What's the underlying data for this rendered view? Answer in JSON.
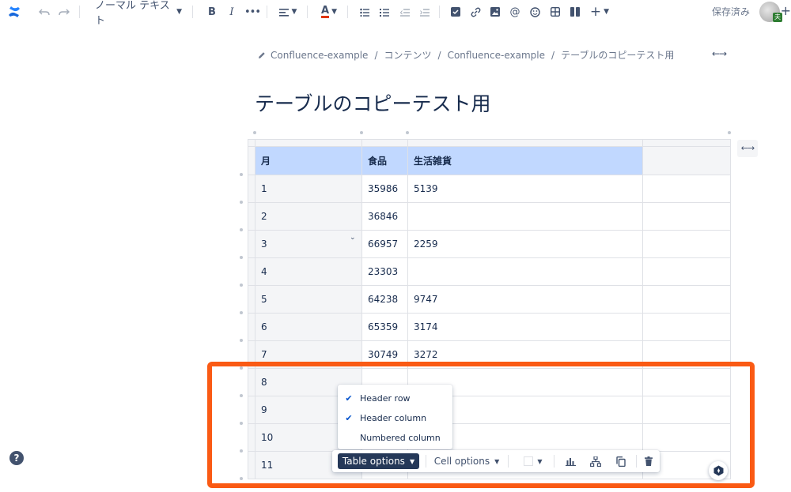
{
  "toolbar": {
    "text_style": "ノーマル テキスト",
    "saved_status": "保存済み",
    "avatar_badge": "夫"
  },
  "breadcrumb": [
    "Confluence-example",
    "コンテンツ",
    "Confluence-example",
    "テーブルのコピーテスト用"
  ],
  "page_title": "テーブルのコピーテスト用",
  "table": {
    "headers": [
      "月",
      "食品",
      "生活雑貨",
      ""
    ],
    "rows": [
      [
        "1",
        "35986",
        "5139",
        ""
      ],
      [
        "2",
        "36846",
        "",
        ""
      ],
      [
        "3",
        "66957",
        "2259",
        ""
      ],
      [
        "4",
        "23303",
        "",
        ""
      ],
      [
        "5",
        "64238",
        "9747",
        ""
      ],
      [
        "6",
        "65359",
        "3174",
        ""
      ],
      [
        "7",
        "30749",
        "3272",
        ""
      ],
      [
        "8",
        "",
        "",
        ""
      ],
      [
        "9",
        "",
        "",
        ""
      ],
      [
        "10",
        "",
        "",
        ""
      ],
      [
        "11",
        "",
        "",
        ""
      ]
    ]
  },
  "table_options_menu": {
    "items": [
      {
        "label": "Header row",
        "checked": true
      },
      {
        "label": "Header column",
        "checked": true
      },
      {
        "label": "Numbered column",
        "checked": false
      }
    ]
  },
  "floating_toolbar": {
    "table_options_label": "Table options",
    "cell_options_label": "Cell options"
  },
  "help_label": "?",
  "colors": {
    "header_row": "#c1d8ff",
    "highlight": "#fa5a14",
    "primary_button": "#253858",
    "check": "#0052cc"
  }
}
